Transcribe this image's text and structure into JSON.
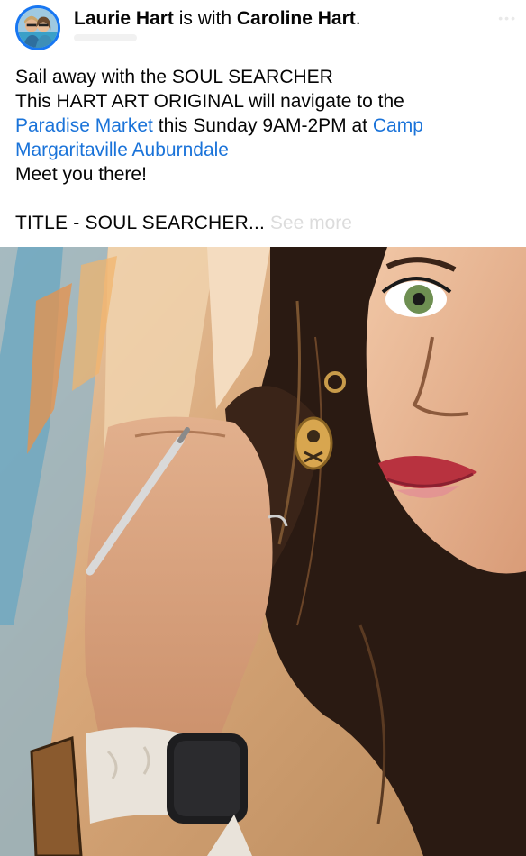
{
  "post": {
    "author": "Laurie Hart",
    "connector": " is with ",
    "tagged": "Caroline Hart",
    "end_punct": ".",
    "caption": {
      "line1": "Sail away with the SOUL SEARCHER",
      "line2": "This HART ART ORIGINAL will navigate to the",
      "link1": "Paradise Market",
      "line3_mid": " this Sunday 9AM-2PM at ",
      "link2a": "Camp",
      "link2b": "Margaritaville Auburndale",
      "line5": "Meet you there!",
      "title_line": "TITLE  -  SOUL SEARCHER...",
      "see_more": "See more"
    }
  },
  "icons": {
    "avatar": "profile-photo",
    "more": "more-options-icon"
  },
  "colors": {
    "link": "#1a73d9",
    "avatar_ring": "#1877f2",
    "text": "#050505"
  }
}
